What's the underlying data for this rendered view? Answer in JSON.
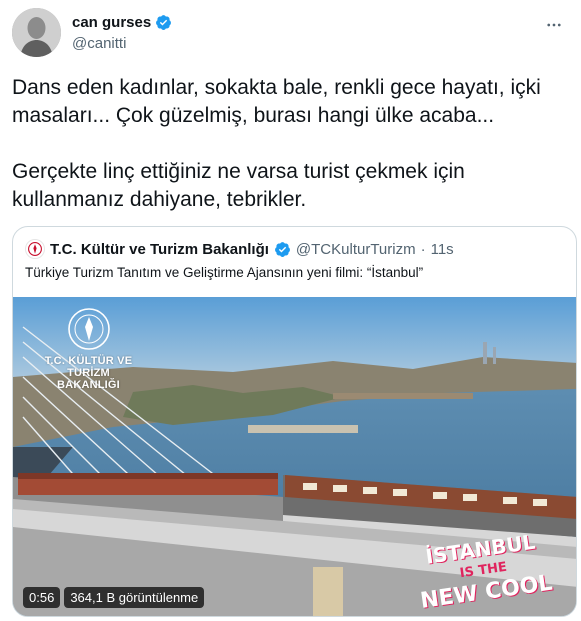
{
  "tweet": {
    "author": {
      "display_name": "can gurses",
      "handle": "@canitti",
      "verified": true
    },
    "text": "Dans eden kadınlar, sokakta bale, renkli gece hayatı, içki masaları... Çok güzelmiş, burası hangi ülke acaba...\n\nGerçekte linç ettiğiniz ne varsa turist çekmek için kullanmanız dahiyane, tebrikler."
  },
  "quoted_tweet": {
    "author": {
      "display_name": "T.C. Kültür ve Turizm Bakanlığı",
      "handle": "@TCKulturTurizm",
      "verified": true
    },
    "separator": "·",
    "time": "11s",
    "text": "Türkiye Turizm Tanıtım ve Geliştirme Ajansının yeni filmi: “İstanbul”",
    "video": {
      "duration": "0:56",
      "views": "364,1 B görüntülenme",
      "watermark_lines": [
        "T.C. KÜLTÜR VE TURİZM",
        "BAKANLIĞI"
      ],
      "promo_lines": [
        "İSTANBUL",
        "IS THE",
        "NEW COOL"
      ]
    }
  },
  "icons": {
    "verified": "verified-badge-icon",
    "more": "more-options-icon",
    "ministry": "ministry-seal-icon"
  },
  "colors": {
    "verified_blue": "#1d9bf0",
    "secondary_text": "#536471",
    "border": "#cfd9de",
    "promo_pink": "#e0245e"
  }
}
